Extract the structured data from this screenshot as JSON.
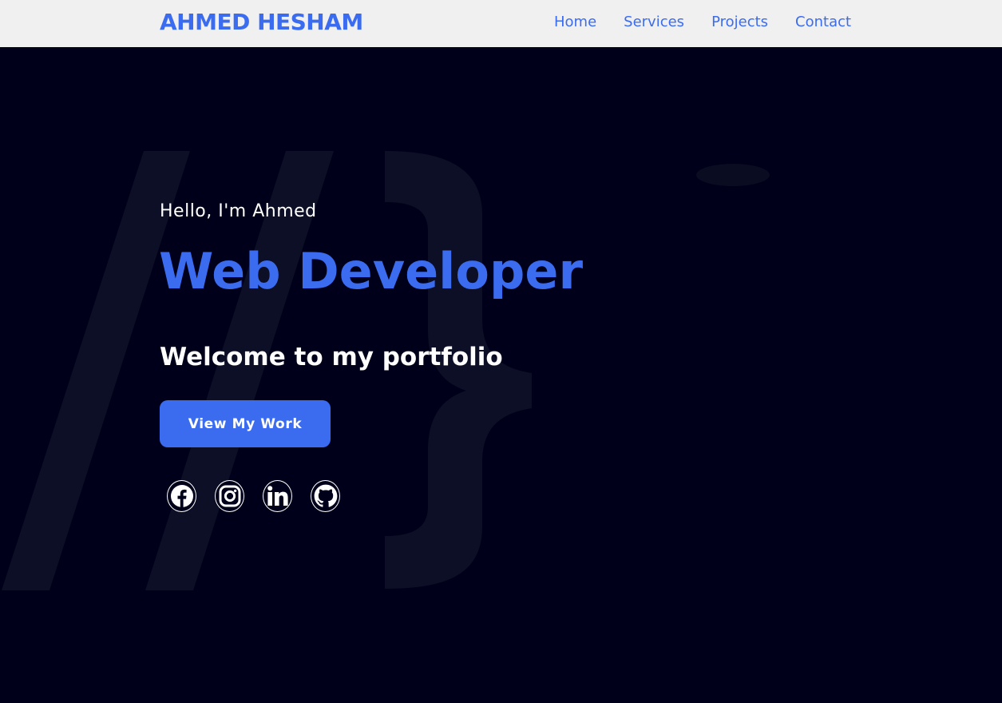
{
  "header": {
    "brand": "AHMED HESHAM",
    "nav": [
      {
        "label": "Home"
      },
      {
        "label": "Services"
      },
      {
        "label": "Projects"
      },
      {
        "label": "Contact"
      }
    ]
  },
  "hero": {
    "greeting": "Hello, I'm Ahmed",
    "role": "Web Developer",
    "welcome": "Welcome to my portfolio",
    "cta_label": "View My Work",
    "socials": [
      {
        "icon": "facebook-icon"
      },
      {
        "icon": "instagram-icon"
      },
      {
        "icon": "linkedin-icon"
      },
      {
        "icon": "github-icon"
      }
    ]
  },
  "colors": {
    "accent": "#3b6cf0",
    "background": "#00001a",
    "navbar": "#f0f0f0",
    "text": "#ffffff"
  }
}
